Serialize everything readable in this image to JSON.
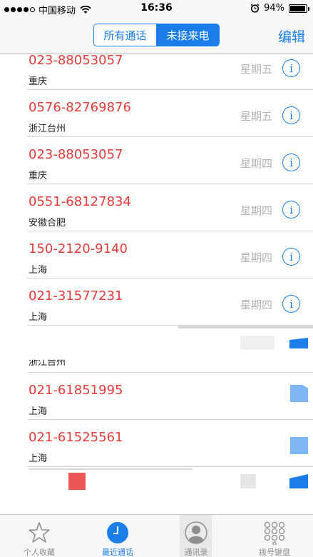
{
  "status_bar": {
    "carrier": "中国移动",
    "time": "16:36",
    "battery": "94%",
    "battery_level": 0.94,
    "icons": [
      "signal-dots-icon",
      "wifi-icon",
      "alarm-icon",
      "battery-icon"
    ]
  },
  "nav": {
    "segments": [
      "所有通话",
      "未接来电"
    ],
    "selected_segment": "未接来电",
    "edit_label": "编辑"
  },
  "calls": [
    {
      "number": "023-88053057",
      "location": "重庆",
      "day": "星期五"
    },
    {
      "number": "0576-82769876",
      "location": "浙江台州",
      "day": "星期五"
    },
    {
      "number": "023-88053057",
      "location": "重庆",
      "day": "星期四"
    },
    {
      "number": "0551-68127834",
      "location": "安徽合肥",
      "day": "星期四"
    },
    {
      "number": "150-2120-9140",
      "location": "上海",
      "day": "星期四"
    },
    {
      "number": "021-31577231",
      "location": "上海",
      "day": "星期四"
    },
    {
      "number": "",
      "location": "浙江台州",
      "day": ""
    },
    {
      "number": "021-61851995",
      "location": "上海",
      "day": ""
    },
    {
      "number": "021-61525561",
      "location": "上海",
      "day": ""
    }
  ],
  "info_glyph": "i",
  "colors": {
    "accent": "#1a7dea",
    "missed_call_red": "#e53b3b",
    "day_gray": "#b3b3b3"
  },
  "tabs": [
    {
      "label": "个人收藏",
      "icon": "star-icon"
    },
    {
      "label": "最近通话",
      "icon": "clock-icon",
      "active": true
    },
    {
      "label": "通讯录",
      "icon": "contacts-icon"
    },
    {
      "label": "拨号键盘",
      "icon": "keypad-icon"
    }
  ]
}
